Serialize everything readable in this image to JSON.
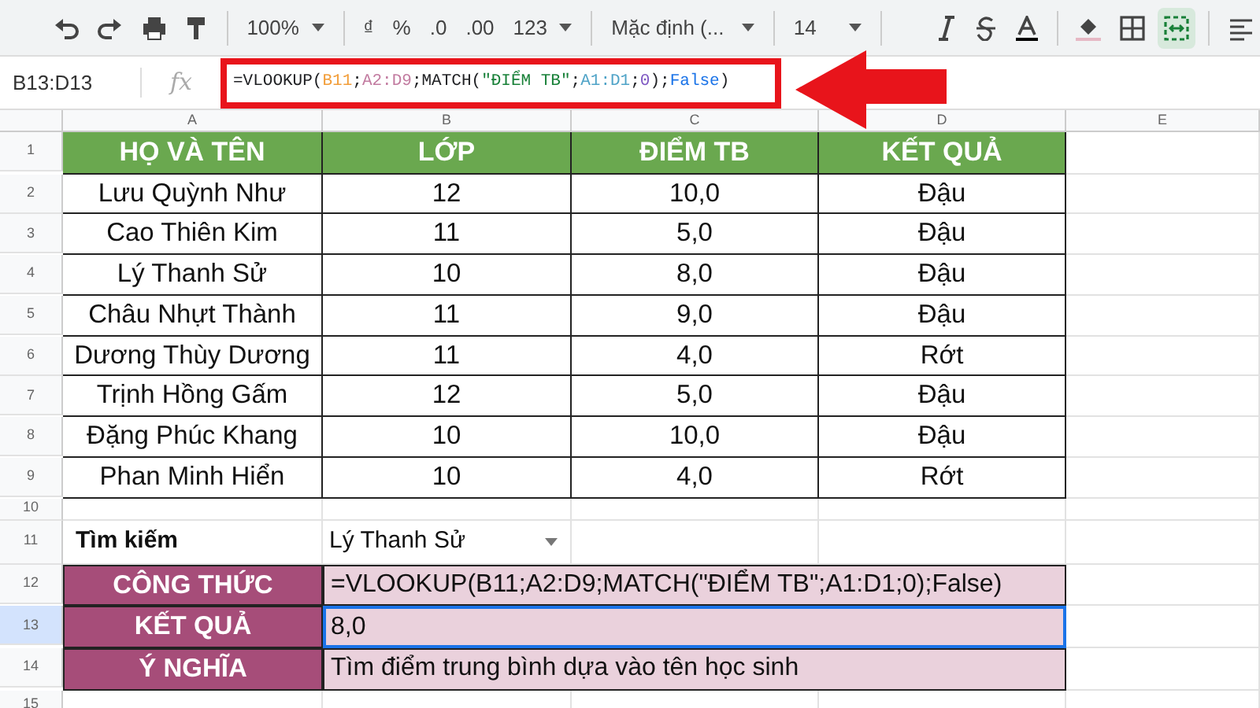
{
  "toolbar": {
    "zoom": "100%",
    "currency": "₫",
    "percent": "%",
    "decrease_decimal": ".0",
    "increase_decimal": ".00",
    "number_format": "123",
    "font": "Mặc định (...",
    "font_size": "14",
    "merge_selected": true
  },
  "name_box": "B13:D13",
  "fx": "fx",
  "formula": [
    {
      "text": "=VLOOKUP(",
      "color": "#202124"
    },
    {
      "text": "B11",
      "color": "#f29d38"
    },
    {
      "text": ";",
      "color": "#202124"
    },
    {
      "text": "A2:D9",
      "color": "#c27ba0"
    },
    {
      "text": ";MATCH(",
      "color": "#202124"
    },
    {
      "text": "\"ĐIỂM TB\"",
      "color": "#188038"
    },
    {
      "text": ";",
      "color": "#202124"
    },
    {
      "text": "A1:D1",
      "color": "#4fa3c7"
    },
    {
      "text": ";",
      "color": "#202124"
    },
    {
      "text": "0",
      "color": "#7e57c2"
    },
    {
      "text": ");",
      "color": "#202124"
    },
    {
      "text": "False",
      "color": "#1a73e8"
    },
    {
      "text": ")",
      "color": "#202124"
    }
  ],
  "columns": [
    "A",
    "B",
    "C",
    "D",
    "E"
  ],
  "rows": [
    {
      "number": "1",
      "kind": "header",
      "selected": false,
      "cells": [
        "HỌ VÀ TÊN",
        "LỚP",
        "ĐIỂM TB",
        "KẾT QUẢ"
      ]
    },
    {
      "number": "2",
      "kind": "data",
      "selected": false,
      "cells": [
        "Lưu Quỳnh Như",
        "12",
        "10,0",
        "Đậu"
      ]
    },
    {
      "number": "3",
      "kind": "data",
      "selected": false,
      "cells": [
        "Cao Thiên Kim",
        "11",
        "5,0",
        "Đậu"
      ]
    },
    {
      "number": "4",
      "kind": "data",
      "selected": false,
      "cells": [
        "Lý Thanh Sử",
        "10",
        "8,0",
        "Đậu"
      ]
    },
    {
      "number": "5",
      "kind": "data",
      "selected": false,
      "cells": [
        "Châu Nhựt Thành",
        "11",
        "9,0",
        "Đậu"
      ]
    },
    {
      "number": "6",
      "kind": "data",
      "selected": false,
      "cells": [
        "Dương Thùy Dương",
        "11",
        "4,0",
        "Rớt"
      ]
    },
    {
      "number": "7",
      "kind": "data",
      "selected": false,
      "cells": [
        "Trịnh Hồng Gấm",
        "12",
        "5,0",
        "Đậu"
      ]
    },
    {
      "number": "8",
      "kind": "data",
      "selected": false,
      "cells": [
        "Đặng Phúc Khang",
        "10",
        "10,0",
        "Đậu"
      ]
    },
    {
      "number": "9",
      "kind": "data",
      "selected": false,
      "cells": [
        "Phan Minh Hiển",
        "10",
        "4,0",
        "Rớt"
      ]
    },
    {
      "number": "10",
      "kind": "empty",
      "selected": false,
      "cells": []
    },
    {
      "number": "11",
      "kind": "search",
      "selected": false,
      "cells": [
        "Tìm kiếm",
        "Lý Thanh Sử"
      ]
    },
    {
      "number": "12",
      "kind": "result",
      "selected": false,
      "cells": [
        "CÔNG THỨC",
        "=VLOOKUP(B11;A2:D9;MATCH(\"ĐIỂM TB\";A1:D1;0);False)"
      ]
    },
    {
      "number": "13",
      "kind": "result",
      "selected": true,
      "cells": [
        "KẾT QUẢ",
        "8,0"
      ]
    },
    {
      "number": "14",
      "kind": "result",
      "selected": false,
      "cells": [
        "Ý NGHĨA",
        "Tìm điểm trung bình dựa vào tên học sinh"
      ]
    },
    {
      "number": "15",
      "kind": "empty",
      "selected": false,
      "cells": []
    }
  ]
}
